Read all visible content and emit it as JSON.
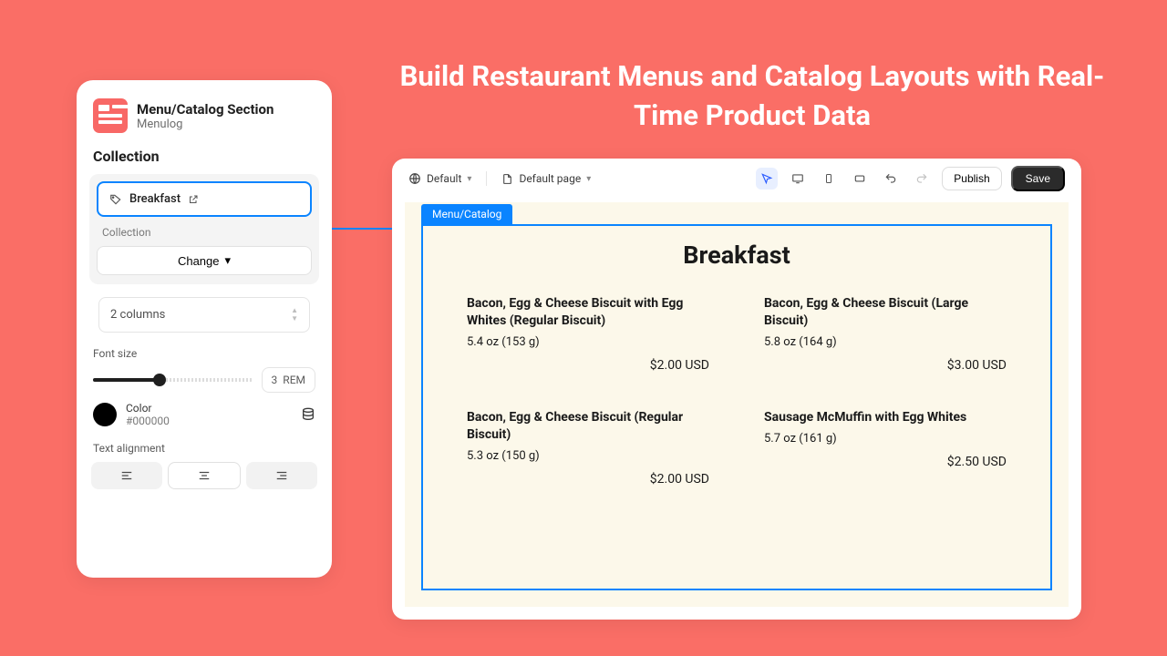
{
  "headline": "Build Restaurant Menus and Catalog Layouts with Real-Time Product Data",
  "sidebar": {
    "app_title": "Menu/Catalog Section",
    "app_subtitle": "Menulog",
    "section_label": "Collection",
    "selected_collection": "Breakfast",
    "collection_sublabel": "Collection",
    "change_label": "Change",
    "columns_label": "2 columns",
    "font_size_label": "Font size",
    "font_size_value": "3",
    "font_size_unit": "REM",
    "color_label": "Color",
    "color_hex": "#000000",
    "text_align_label": "Text alignment"
  },
  "toolbar": {
    "variant_label": "Default",
    "page_label": "Default page",
    "publish_label": "Publish",
    "save_label": "Save"
  },
  "stage": {
    "selection_label": "Menu/Catalog",
    "title": "Breakfast",
    "items": [
      {
        "name": "Bacon, Egg & Cheese Biscuit with Egg Whites (Regular Biscuit)",
        "sub": "5.4 oz (153 g)",
        "price": "$2.00 USD"
      },
      {
        "name": "Bacon, Egg & Cheese Biscuit (Large Biscuit)",
        "sub": "5.8 oz (164 g)",
        "price": "$3.00 USD"
      },
      {
        "name": "Bacon, Egg & Cheese Biscuit (Regular Biscuit)",
        "sub": "5.3 oz (150 g)",
        "price": "$2.00 USD"
      },
      {
        "name": "Sausage McMuffin with Egg Whites",
        "sub": "5.7 oz (161 g)",
        "price": "$2.50 USD"
      }
    ]
  }
}
